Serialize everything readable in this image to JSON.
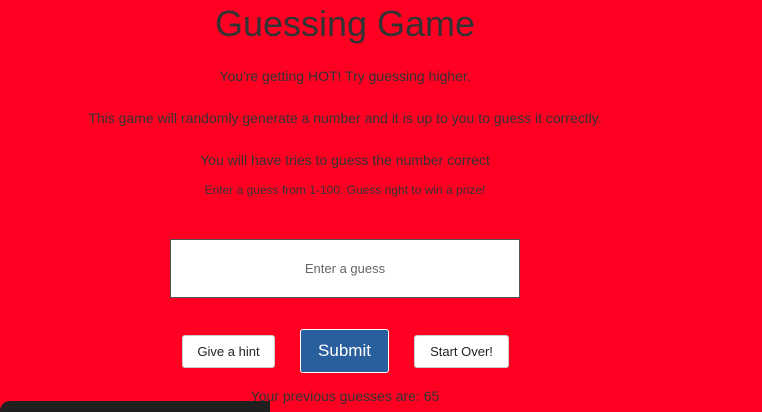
{
  "game": {
    "title": "Guessing Game",
    "status_message": "You're getting HOT! Try guessing higher.",
    "description": "This game will randomly generate a number and it is up to you to guess it correctly.",
    "tries_message": "You will have tries to guess the number correct",
    "instructions": "Enter a guess from 1-100. Guess right to win a prize!"
  },
  "input": {
    "value": "",
    "placeholder": "Enter a guess"
  },
  "buttons": {
    "hint_label": "Give a hint",
    "submit_label": "Submit",
    "restart_label": "Start Over!"
  },
  "history": {
    "label": "Your previous guesses are: 65"
  },
  "colors": {
    "background": "#ff0022",
    "submit_button": "#2a5f9e",
    "text": "#333333"
  }
}
